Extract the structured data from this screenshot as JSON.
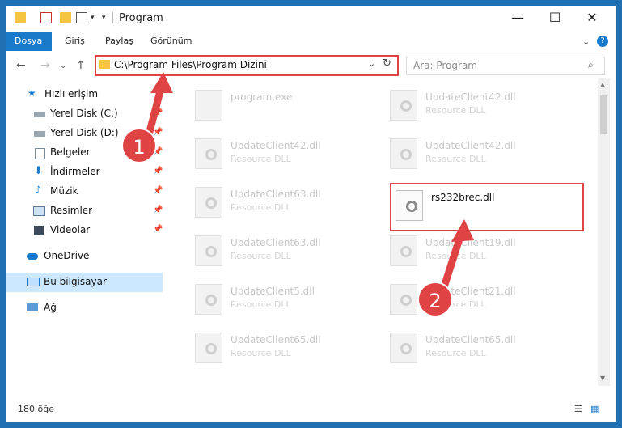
{
  "window": {
    "title": "Program",
    "controls": {
      "minimize": "—",
      "maximize": "☐",
      "close": "✕"
    }
  },
  "ribbon": {
    "tabs": [
      "Dosya",
      "Giriş",
      "Paylaş",
      "Görünüm"
    ],
    "active_tab": "Dosya",
    "accent_color": "#1979ca"
  },
  "address_bar": {
    "path": "C:\\Program Files\\Program Dizini"
  },
  "search": {
    "placeholder": "Ara: Program"
  },
  "sidebar": {
    "items": [
      {
        "label": "Hızlı erişim",
        "icon": "star-icon"
      },
      {
        "label": "Yerel Disk (C:)",
        "icon": "drive-icon",
        "pinned": true
      },
      {
        "label": "Yerel Disk (D:)",
        "icon": "drive-icon",
        "pinned": true
      },
      {
        "label": "Belgeler",
        "icon": "documents-icon",
        "pinned": true
      },
      {
        "label": "İndirmeler",
        "icon": "download-icon",
        "pinned": true
      },
      {
        "label": "Müzik",
        "icon": "music-icon",
        "pinned": true
      },
      {
        "label": "Resimler",
        "icon": "pictures-icon",
        "pinned": true
      },
      {
        "label": "Videolar",
        "icon": "video-icon",
        "pinned": true
      },
      {
        "label": "OneDrive",
        "icon": "cloud-icon"
      },
      {
        "label": "Bu bilgisayar",
        "icon": "computer-icon",
        "selected": true
      },
      {
        "label": "Ağ",
        "icon": "network-icon"
      }
    ]
  },
  "files": [
    {
      "name": "program.exe",
      "type": ""
    },
    {
      "name": "UpdateClient42.dll",
      "type": "Resource DLL"
    },
    {
      "name": "UpdateClient42.dll",
      "type": "Resource DLL"
    },
    {
      "name": "UpdateClient42.dll",
      "type": "Resource DLL"
    },
    {
      "name": "UpdateClient63.dll",
      "type": "Resource DLL"
    },
    {
      "name": "rs232brec.dll",
      "type": "",
      "highlighted": true
    },
    {
      "name": "UpdateClient63.dll",
      "type": "Resource DLL"
    },
    {
      "name": "UpdateClient19.dll",
      "type": "Resource DLL"
    },
    {
      "name": "UpdateClient5.dll",
      "type": "Resource DLL"
    },
    {
      "name": "UpdateClient21.dll",
      "type": "Resource DLL"
    },
    {
      "name": "UpdateClient65.dll",
      "type": "Resource DLL"
    },
    {
      "name": "UpdateClient65.dll",
      "type": "Resource DLL"
    }
  ],
  "status": {
    "item_count": "180 öğe"
  },
  "annotations": {
    "step1": "1",
    "step2": "2",
    "color": "#e04343"
  }
}
